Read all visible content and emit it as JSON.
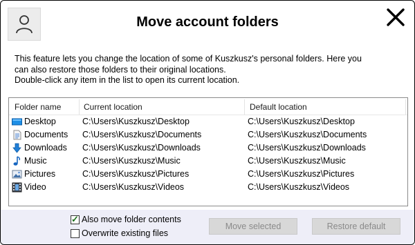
{
  "dialog": {
    "title": "Move account folders",
    "description": [
      "This feature lets you change the location of some of Kuszkusz's personal folders. Here you",
      "can also restore those folders to their original locations.",
      "Double-click any item in the list to open its current location."
    ]
  },
  "table": {
    "headers": [
      "Folder name",
      "Current location",
      "Default location"
    ],
    "rows": [
      {
        "icon": "desktop-folder-icon",
        "name": "Desktop",
        "current": "C:\\Users\\Kuszkusz\\Desktop",
        "default": "C:\\Users\\Kuszkusz\\Desktop"
      },
      {
        "icon": "documents-folder-icon",
        "name": "Documents",
        "current": "C:\\Users\\Kuszkusz\\Documents",
        "default": "C:\\Users\\Kuszkusz\\Documents"
      },
      {
        "icon": "downloads-folder-icon",
        "name": "Downloads",
        "current": "C:\\Users\\Kuszkusz\\Downloads",
        "default": "C:\\Users\\Kuszkusz\\Downloads"
      },
      {
        "icon": "music-folder-icon",
        "name": "Music",
        "current": "C:\\Users\\Kuszkusz\\Music",
        "default": "C:\\Users\\Kuszkusz\\Music"
      },
      {
        "icon": "pictures-folder-icon",
        "name": "Pictures",
        "current": "C:\\Users\\Kuszkusz\\Pictures",
        "default": "C:\\Users\\Kuszkusz\\Pictures"
      },
      {
        "icon": "video-folder-icon",
        "name": "Video",
        "current": "C:\\Users\\Kuszkusz\\Videos",
        "default": "C:\\Users\\Kuszkusz\\Videos"
      }
    ]
  },
  "options": {
    "move_contents": {
      "label": "Also move folder contents",
      "checked": true
    },
    "overwrite": {
      "label": "Overwrite existing files",
      "checked": false
    }
  },
  "buttons": {
    "move_selected": "Move selected",
    "restore_default": "Restore default"
  },
  "colors": {
    "footer_bg": "#eeeef8",
    "disabled_button_bg": "#d8d8d8",
    "disabled_button_text": "#8a8a8a"
  }
}
